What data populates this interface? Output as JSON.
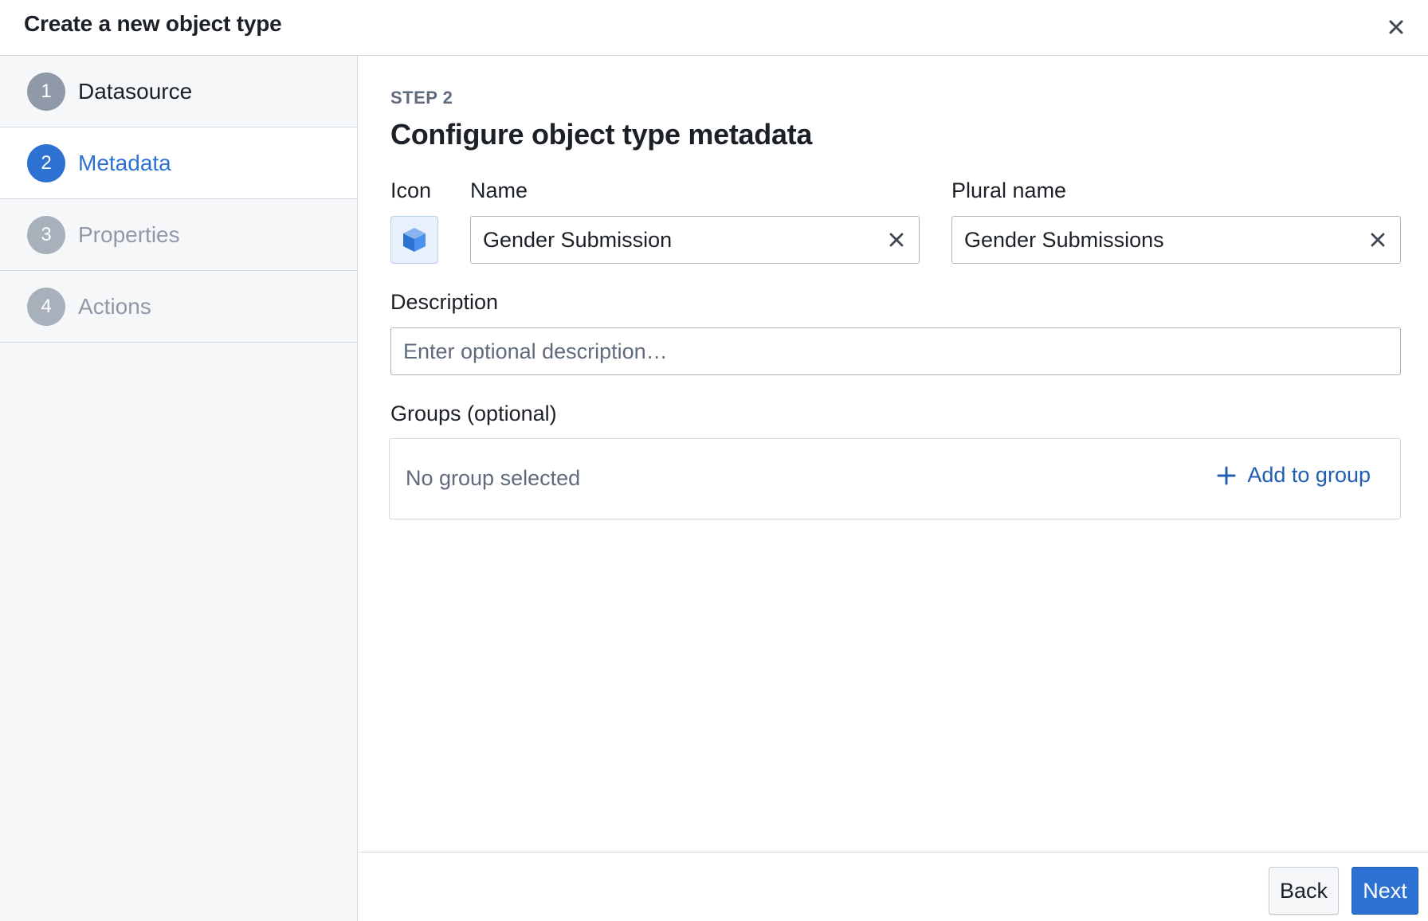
{
  "dialog": {
    "title": "Create a new object type"
  },
  "sidebar": {
    "steps": [
      {
        "number": "1",
        "label": "Datasource"
      },
      {
        "number": "2",
        "label": "Metadata"
      },
      {
        "number": "3",
        "label": "Properties"
      },
      {
        "number": "4",
        "label": "Actions"
      }
    ]
  },
  "main": {
    "eyebrow": "STEP 2",
    "title": "Configure object type metadata",
    "icon_label": "Icon",
    "icon_name": "cube-icon",
    "name_label": "Name",
    "name_value": "Gender Submission",
    "plural_label": "Plural name",
    "plural_value": "Gender Submissions",
    "description_label": "Description",
    "description_placeholder": "Enter optional description…",
    "groups_label": "Groups (optional)",
    "groups_empty": "No group selected",
    "add_group_label": "Add to group"
  },
  "footer": {
    "back_label": "Back",
    "next_label": "Next"
  },
  "colors": {
    "accent": "#2d72d2",
    "link": "#215db0",
    "muted_step": "#a7b0bb"
  }
}
